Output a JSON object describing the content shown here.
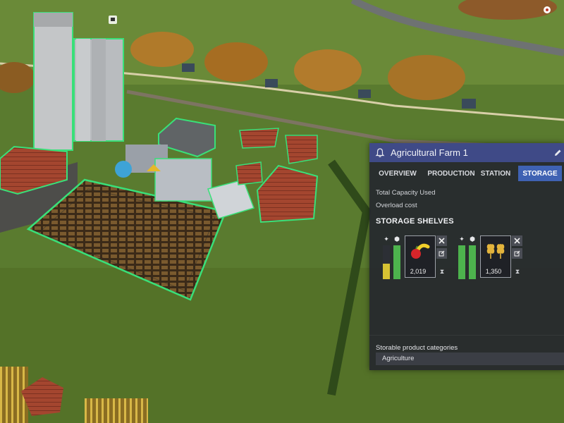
{
  "panel": {
    "title": "Agricultural Farm 1",
    "tabs": [
      {
        "label": "OVERVIEW"
      },
      {
        "label": "PRODUCTION"
      },
      {
        "label": "STATION"
      },
      {
        "label": "STORAGE"
      }
    ],
    "active_tab": "STORAGE",
    "total_capacity_label": "Total Capacity Used",
    "overload_cost_label": "Overload cost",
    "section_title": "STORAGE SHELVES",
    "shelves": [
      {
        "product_icon": "fruit-icon",
        "quantity": "2,019",
        "fill_fraction_a": 0.45,
        "fill_fraction_b": 1.0,
        "color_a": "#d7c233",
        "color_b": "#4db34d"
      },
      {
        "product_icon": "wheat-icon",
        "quantity": "1,350",
        "fill_fraction_a": 1.0,
        "fill_fraction_b": 1.0,
        "color_a": "#4db34d",
        "color_b": "#4db34d"
      }
    ],
    "categories_label": "Storable product categories",
    "categories_value": "Agriculture"
  },
  "colors": {
    "panel_header": "#3f4a87",
    "active_tab": "#3f62b3",
    "selection_outline": "#39e079"
  }
}
